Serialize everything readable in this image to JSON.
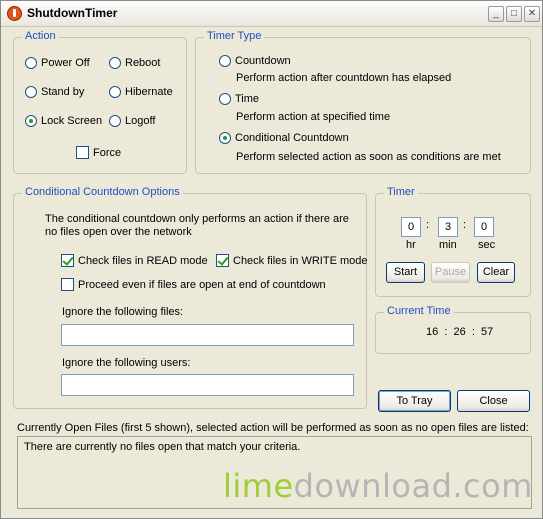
{
  "window": {
    "title": "ShutdownTimer"
  },
  "title_buttons": {
    "minimize": "_",
    "maximize": "□",
    "close": "✕"
  },
  "action": {
    "title": "Action",
    "options": [
      "Power Off",
      "Reboot",
      "Stand by",
      "Hibernate",
      "Lock Screen",
      "Logoff"
    ],
    "selected": "Lock Screen",
    "force_label": "Force",
    "force_checked": false
  },
  "timer_type": {
    "title": "Timer Type",
    "options": [
      {
        "label": "Countdown",
        "desc": "Perform action after countdown has elapsed"
      },
      {
        "label": "Time",
        "desc": "Perform action at specified time"
      },
      {
        "label": "Conditional Countdown",
        "desc": "Perform selected action as soon as conditions are met"
      }
    ],
    "selected": "Conditional Countdown"
  },
  "conditional": {
    "title": "Conditional Countdown Options",
    "description_line1": "The conditional countdown only performs an action if there are",
    "description_line2": "no files open over the network",
    "check_read": {
      "label": "Check files in READ mode",
      "checked": true
    },
    "check_write": {
      "label": "Check files in WRITE mode",
      "checked": true
    },
    "proceed": {
      "label": "Proceed even if files are open at end of countdown",
      "checked": false
    },
    "ignore_files_label": "Ignore the following files:",
    "ignore_files_value": "",
    "ignore_users_label": "Ignore the following users:",
    "ignore_users_value": ""
  },
  "timer": {
    "title": "Timer",
    "hr": "0",
    "min": "3",
    "sec": "0",
    "separator": ":",
    "hr_label": "hr",
    "min_label": "min",
    "sec_label": "sec",
    "start_label": "Start",
    "pause_label": "Pause",
    "clear_label": "Clear"
  },
  "current_time": {
    "title": "Current Time",
    "value": "16  :  26  :  57"
  },
  "buttons": {
    "tray": "To Tray",
    "close": "Close"
  },
  "open_files": {
    "caption": "Currently Open Files (first 5 shown), selected action will be performed as soon as no open files are listed:",
    "message": "There are currently no files open that match your criteria."
  },
  "watermark": {
    "part1": "lime",
    "part2": "download.com"
  }
}
